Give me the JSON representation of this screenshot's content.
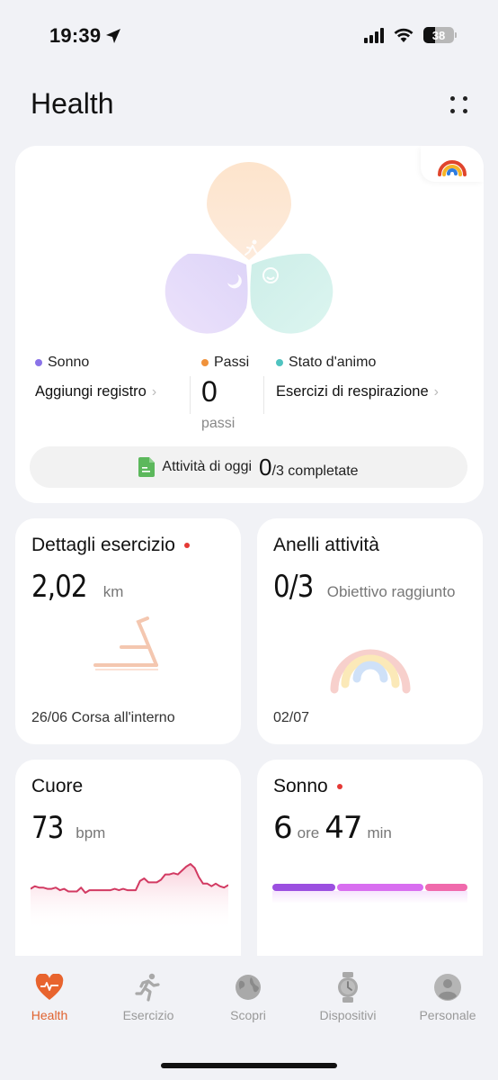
{
  "status_bar": {
    "time": "19:39",
    "battery_level": "38",
    "icons": [
      "location-arrow-icon",
      "cellular-signal-icon",
      "wifi-icon",
      "battery-icon"
    ]
  },
  "header": {
    "title": "Health",
    "menu_icon": "more-dots-icon"
  },
  "summary": {
    "rainbow_icon": "activity-rings-icon",
    "petals": [
      {
        "name": "Passi",
        "color": "#fde6cf",
        "icon": "walking-icon"
      },
      {
        "name": "Sonno",
        "color": "#e4dbfa",
        "icon": "moon-icon"
      },
      {
        "name": "Stato d'animo",
        "color": "#d4f3ec",
        "icon": "smile-icon"
      }
    ],
    "legend": [
      {
        "label": "Sonno",
        "color": "#8a73e8"
      },
      {
        "label": "Passi",
        "color": "#f0923b"
      },
      {
        "label": "Stato d'animo",
        "color": "#4fc3c0"
      }
    ],
    "sleep_action": "Aggiungi registro",
    "steps_value": "0",
    "steps_unit": "passi",
    "mood_action": "Esercizi di respirazione",
    "activity_prefix": "Attività di oggi",
    "activity_done": "0",
    "activity_suffix": "/3 completate"
  },
  "cards": {
    "exercise": {
      "title": "Dettagli esercizio",
      "value": "2,02",
      "unit": "km",
      "footer": "26/06 Corsa all'interno",
      "has_alert": true,
      "icon": "treadmill-icon"
    },
    "rings": {
      "title": "Anelli attività",
      "value": "0/3",
      "unit": "Obiettivo raggiunto",
      "footer": "02/07",
      "icon": "activity-rings-icon"
    },
    "heart": {
      "title": "Cuore",
      "value": "73",
      "unit": "bpm",
      "line_color": "#d23a62",
      "series": [
        66,
        68,
        67,
        67,
        66,
        66,
        67,
        65,
        66,
        64,
        64,
        64,
        67,
        63,
        65,
        65,
        65,
        65,
        65,
        65,
        66,
        65,
        66,
        65,
        65,
        65,
        72,
        74,
        71,
        71,
        71,
        73,
        77,
        77,
        78,
        77,
        80,
        83,
        85,
        82,
        75,
        70,
        70,
        68,
        70,
        68,
        67,
        69
      ]
    },
    "sleep": {
      "title": "Sonno",
      "hours": "6",
      "hours_unit": "ore",
      "minutes": "47",
      "minutes_unit": "min",
      "has_alert": true,
      "segments": [
        {
          "stage": "deep",
          "fraction": 0.33,
          "color": "#9b4fe0"
        },
        {
          "stage": "light",
          "fraction": 0.45,
          "color": "#d86ef0"
        },
        {
          "stage": "rem",
          "fraction": 0.22,
          "color": "#f06aac"
        }
      ]
    }
  },
  "tab_bar": {
    "items": [
      {
        "label": "Health",
        "icon": "heart-pulse-icon",
        "active": true
      },
      {
        "label": "Esercizio",
        "icon": "running-icon",
        "active": false
      },
      {
        "label": "Scopri",
        "icon": "globe-icon",
        "active": false
      },
      {
        "label": "Dispositivi",
        "icon": "watch-icon",
        "active": false
      },
      {
        "label": "Personale",
        "icon": "person-icon",
        "active": false
      }
    ]
  }
}
